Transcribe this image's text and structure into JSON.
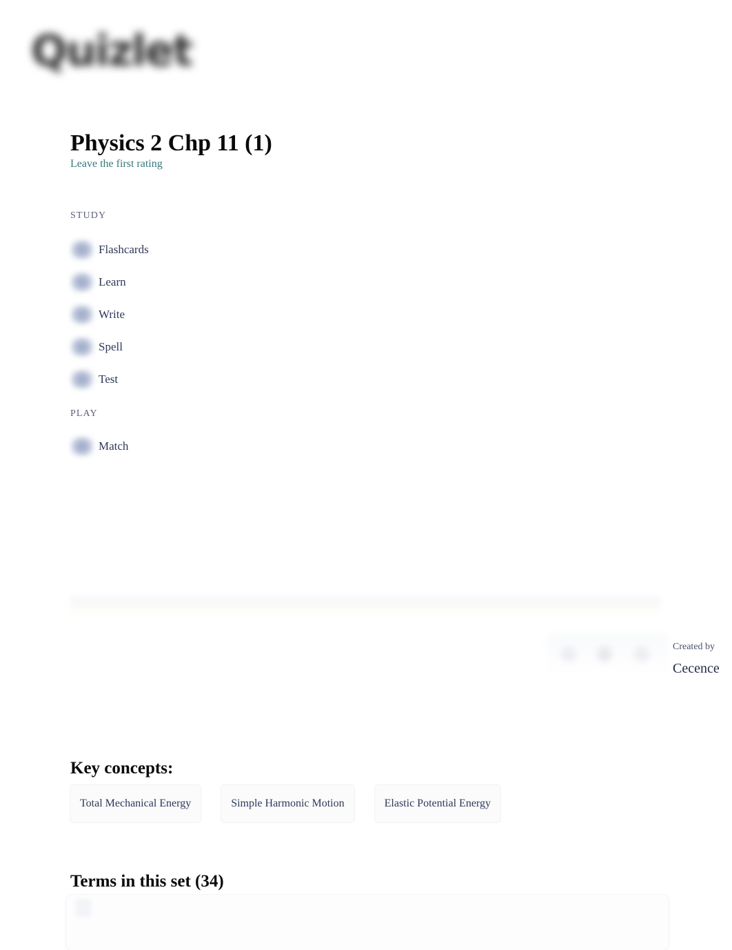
{
  "brand": {
    "logo_text": "Quizlet",
    "logo_icon": "quizlet-logo"
  },
  "header": {
    "title": "Physics 2 Chp 11 (1)",
    "rating_link": "Leave the first rating"
  },
  "modes": {
    "study_label": "STUDY",
    "play_label": "PLAY",
    "study_items": [
      {
        "label": "Flashcards",
        "icon": "flashcards-icon"
      },
      {
        "label": "Learn",
        "icon": "learn-icon"
      },
      {
        "label": "Write",
        "icon": "write-icon"
      },
      {
        "label": "Spell",
        "icon": "spell-icon"
      },
      {
        "label": "Test",
        "icon": "test-icon"
      }
    ],
    "play_items": [
      {
        "label": "Match",
        "icon": "match-icon"
      }
    ]
  },
  "creator": {
    "created_by_label": "Created by",
    "username": "Cecence"
  },
  "key_concepts": {
    "heading": "Key concepts:",
    "chips": [
      "Total Mechanical Energy",
      "Simple Harmonic Motion",
      "Elastic Potential Energy"
    ]
  },
  "terms": {
    "heading": "Terms in this set (34)",
    "count": 34
  },
  "colors": {
    "accent_teal": "#35797b",
    "text_primary": "#0a0a0a",
    "text_navy": "#2e3858",
    "label_gray": "#5b6079"
  }
}
